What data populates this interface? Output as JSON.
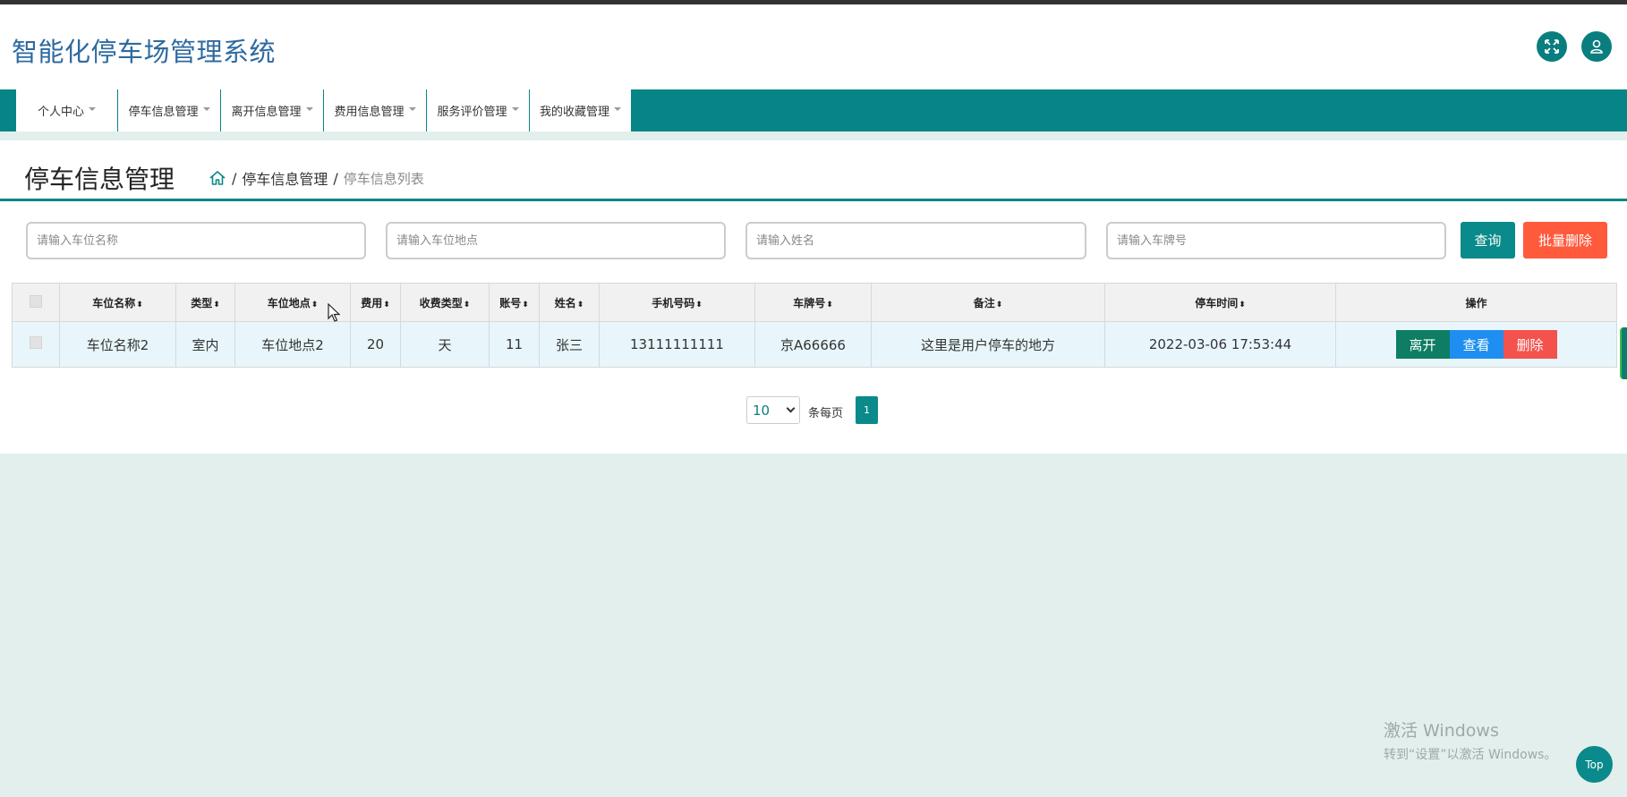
{
  "app": {
    "title": "智能化停车场管理系统"
  },
  "header_icons": {
    "fullscreen": "fullscreen-icon",
    "user": "user-icon"
  },
  "nav": {
    "items": [
      {
        "label": "个人中心"
      },
      {
        "label": "停车信息管理"
      },
      {
        "label": "离开信息管理"
      },
      {
        "label": "费用信息管理"
      },
      {
        "label": "服务评价管理"
      },
      {
        "label": "我的收藏管理"
      }
    ]
  },
  "page": {
    "title": "停车信息管理",
    "breadcrumb": {
      "sep": "/",
      "section": "停车信息管理",
      "current": "停车信息列表"
    }
  },
  "search": {
    "space_name_placeholder": "请输入车位名称",
    "space_location_placeholder": "请输入车位地点",
    "name_placeholder": "请输入姓名",
    "plate_placeholder": "请输入车牌号",
    "query_label": "查询",
    "batch_delete_label": "批量删除"
  },
  "table": {
    "columns": [
      "车位名称",
      "类型",
      "车位地点",
      "费用",
      "收费类型",
      "账号",
      "姓名",
      "手机号码",
      "车牌号",
      "备注",
      "停车时间",
      "操作"
    ],
    "rows": [
      {
        "space_name": "车位名称2",
        "type": "室内",
        "location": "车位地点2",
        "fee": "20",
        "fee_type": "天",
        "account": "11",
        "name": "张三",
        "phone": "13111111111",
        "plate": "京A66666",
        "remark": "这里是用户停车的地方",
        "time": "2022-03-06 17:53:44"
      }
    ],
    "actions": {
      "leave": "离开",
      "view": "查看",
      "delete": "删除"
    }
  },
  "pagination": {
    "page_size": "10",
    "per_page_label": "条每页",
    "current_page": "1"
  },
  "watermark": {
    "line1": "激活 Windows",
    "line2": "转到“设置”以激活 Windows。"
  },
  "back_to_top": {
    "label": "Top"
  },
  "colors": {
    "accent": "#078586",
    "danger": "#ff5a3c",
    "leave": "#0e7d63",
    "view": "#1e8ff0",
    "delete": "#f4524d",
    "title": "#2d6aa0"
  }
}
